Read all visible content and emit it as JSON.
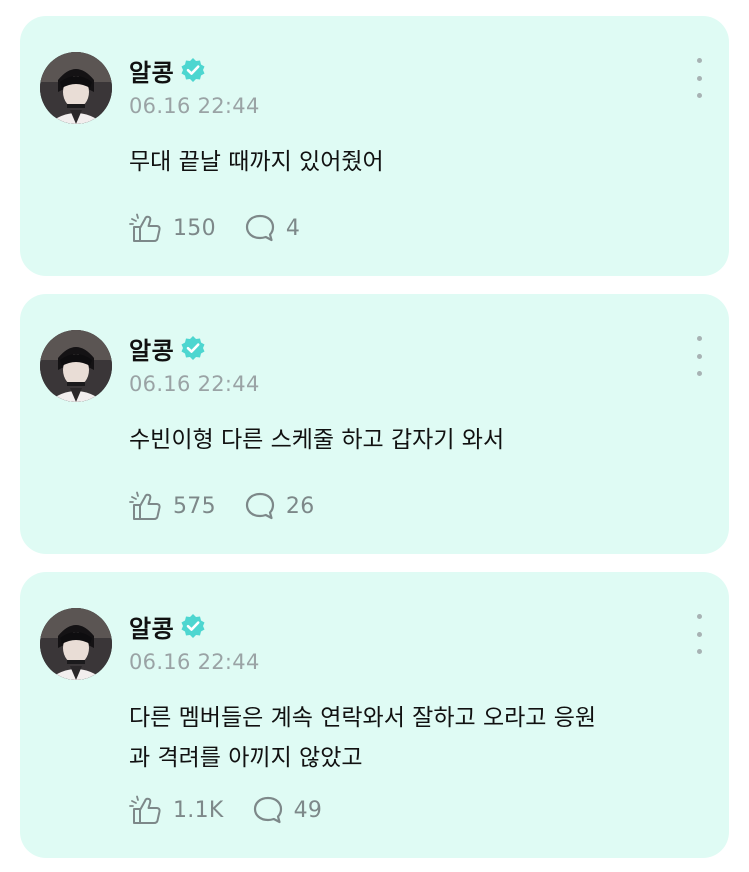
{
  "posts": [
    {
      "author": "알콩",
      "timestamp": "06.16 22:44",
      "text": "무대 끝날 때까지 있어줬어",
      "likes": "150",
      "comments": "4"
    },
    {
      "author": "알콩",
      "timestamp": "06.16 22:44",
      "text": "수빈이형 다른 스케줄 하고 갑자기 와서",
      "likes": "575",
      "comments": "26"
    },
    {
      "author": "알콩",
      "timestamp": "06.16 22:44",
      "text": "다른 멤버들은 계속 연락와서 잘하고 오라고 응원\n과 격려를 아끼지 않았고",
      "likes": "1.1K",
      "comments": "49"
    }
  ],
  "colors": {
    "card_background": "#dffbf4",
    "verified_badge": "#4dd6d0",
    "timestamp_text": "#9aa3a5",
    "icon_gray": "#7d8889"
  },
  "icons": {
    "verified": "verified-badge-icon",
    "like": "like-hand-icon",
    "comment": "comment-bubble-icon",
    "more": "more-vertical-icon"
  }
}
